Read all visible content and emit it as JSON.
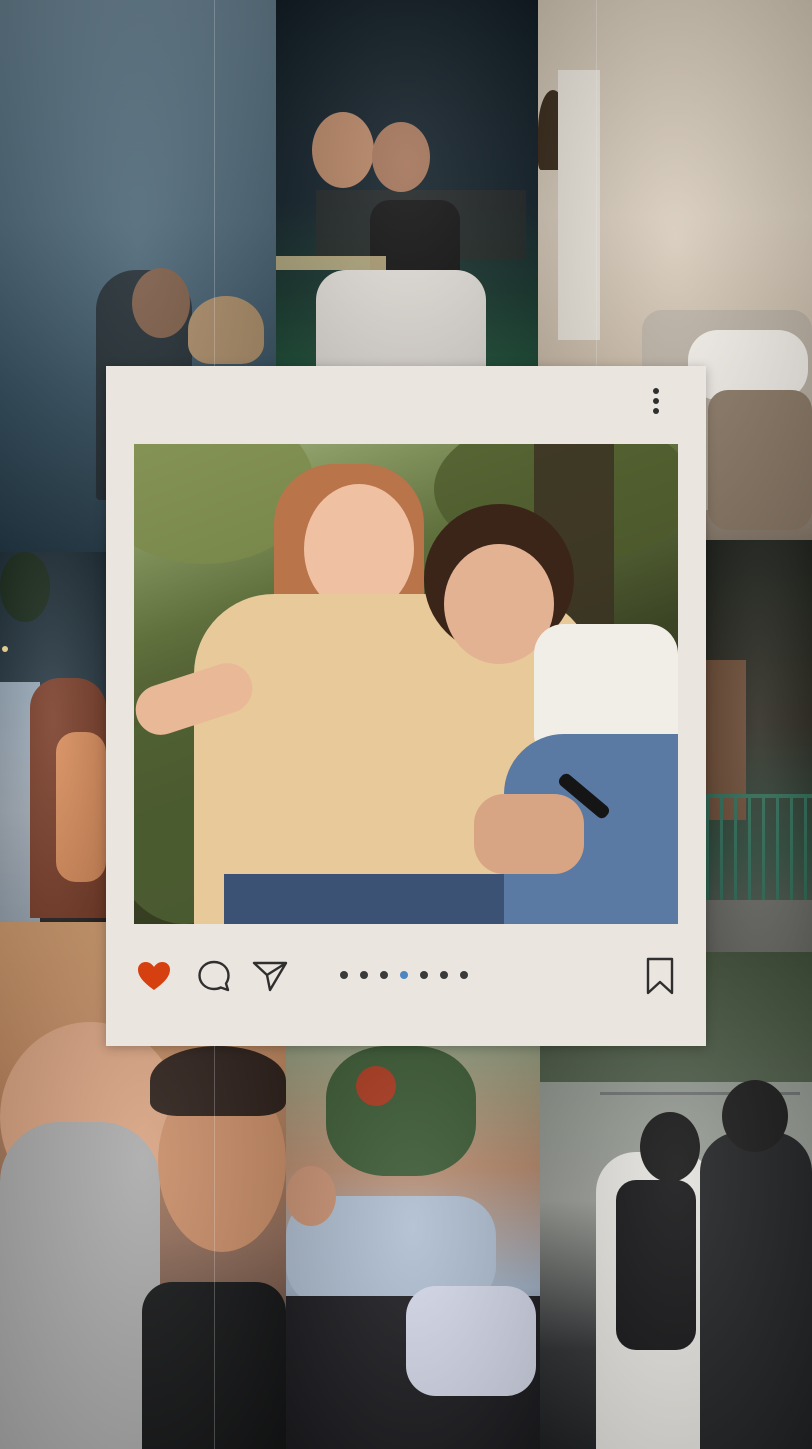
{
  "post": {
    "liked": true,
    "carousel": {
      "count": 7,
      "active_index": 3
    }
  },
  "icons": {
    "more": "vertical-dots-icon",
    "like": "heart-icon",
    "comment": "comment-bubble-icon",
    "share": "paper-plane-icon",
    "save": "bookmark-icon"
  },
  "colors": {
    "card_background": "#ebe5df",
    "like_red": "#d64010",
    "icon_dark": "#2f2f2f",
    "active_dot": "#4a86c2"
  },
  "collage": {
    "tiles": [
      "sea-kiss-photo",
      "piggyback-photo",
      "sofa-photo",
      "night-crowd-photo",
      "balcony-photo",
      "selfie-hoodie-photo",
      "lying-down-photo",
      "walking-photo"
    ]
  }
}
